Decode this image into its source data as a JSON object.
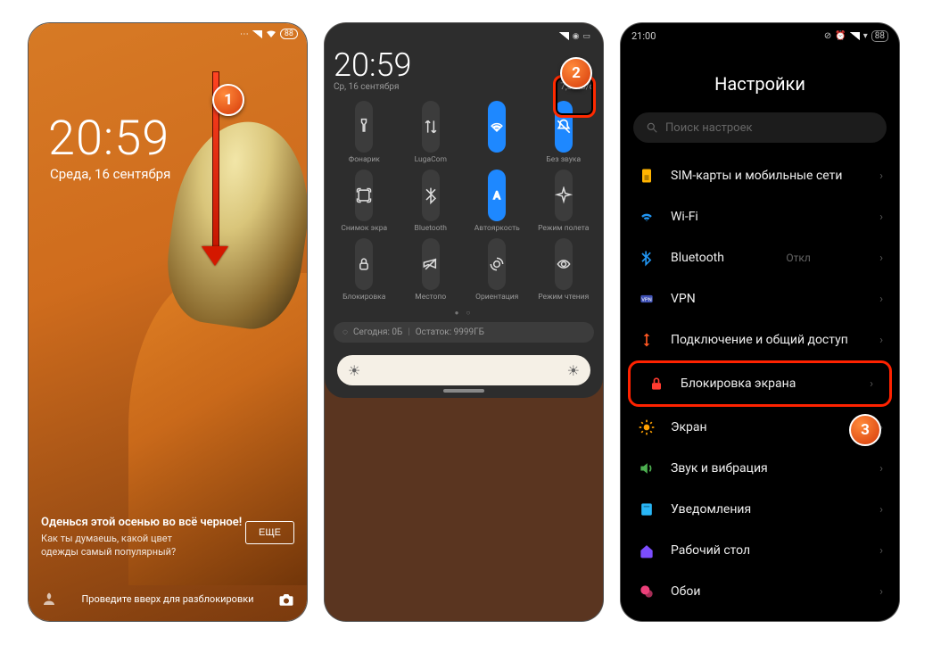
{
  "badges": {
    "b1": "1",
    "b2": "2",
    "b3": "3"
  },
  "screen1": {
    "battery": "88",
    "time": "20:59",
    "date": "Среда, 16 сентября",
    "promo_title": "Оденься этой осенью во всё черное!",
    "promo_sub": "Как ты думаешь, какой цвет одежды самый популярный?",
    "more": "ЕЩЕ",
    "swipe": "Проведите вверх для разблокировки"
  },
  "screen2": {
    "time": "20:59",
    "date": "Ср, 16 сентября",
    "speed": "7,3 КБ/с",
    "tiles": [
      {
        "label": "Фонарик",
        "icon": "flashlight"
      },
      {
        "label": "LugaCom",
        "icon": "data"
      },
      {
        "label": "",
        "icon": "wifi",
        "on": true
      },
      {
        "label": "Без звука",
        "icon": "mute",
        "on": true
      },
      {
        "label": "Снимок экра",
        "icon": "screenshot"
      },
      {
        "label": "Bluetooth",
        "icon": "bluetooth"
      },
      {
        "label": "Автояркость",
        "icon": "autobright",
        "on": true
      },
      {
        "label": "Режим полета",
        "icon": "airplane"
      },
      {
        "label": "Блокировка",
        "icon": "lock"
      },
      {
        "label": "Местопо",
        "icon": "location"
      },
      {
        "label": "Ориентация",
        "icon": "rotate"
      },
      {
        "label": "Режим чтения",
        "icon": "read"
      }
    ],
    "data_today": "Сегодня: 0Б",
    "data_remain": "Остаток: 9999ГБ"
  },
  "screen3": {
    "status_time": "21:00",
    "battery": "88",
    "title": "Настройки",
    "search_placeholder": "Поиск настроек",
    "items": [
      {
        "icon": "sim",
        "label": "SIM-карты и мобильные сети",
        "color": "#ffb300"
      },
      {
        "icon": "wifi",
        "label": "Wi-Fi",
        "value": "",
        "color": "#2196f3"
      },
      {
        "icon": "bluetooth",
        "label": "Bluetooth",
        "value": "Откл",
        "color": "#2196f3"
      },
      {
        "icon": "vpn",
        "label": "VPN",
        "color": "#3f51b5"
      },
      {
        "icon": "share",
        "label": "Подключение и общий доступ",
        "color": "#ff5722"
      },
      {
        "icon": "lock",
        "label": "Блокировка экрана",
        "color": "#ff3b30",
        "gap": true,
        "highlight": true
      },
      {
        "icon": "display",
        "label": "Экран",
        "color": "#ffa000",
        "gap": false
      },
      {
        "icon": "sound",
        "label": "Звук и вибрация",
        "color": "#4caf50"
      },
      {
        "icon": "notif",
        "label": "Уведомления",
        "color": "#29b6f6"
      },
      {
        "icon": "home",
        "label": "Рабочий стол",
        "color": "#7c4dff"
      },
      {
        "icon": "wallpaper",
        "label": "Обои",
        "color": "#ec407a"
      }
    ]
  }
}
